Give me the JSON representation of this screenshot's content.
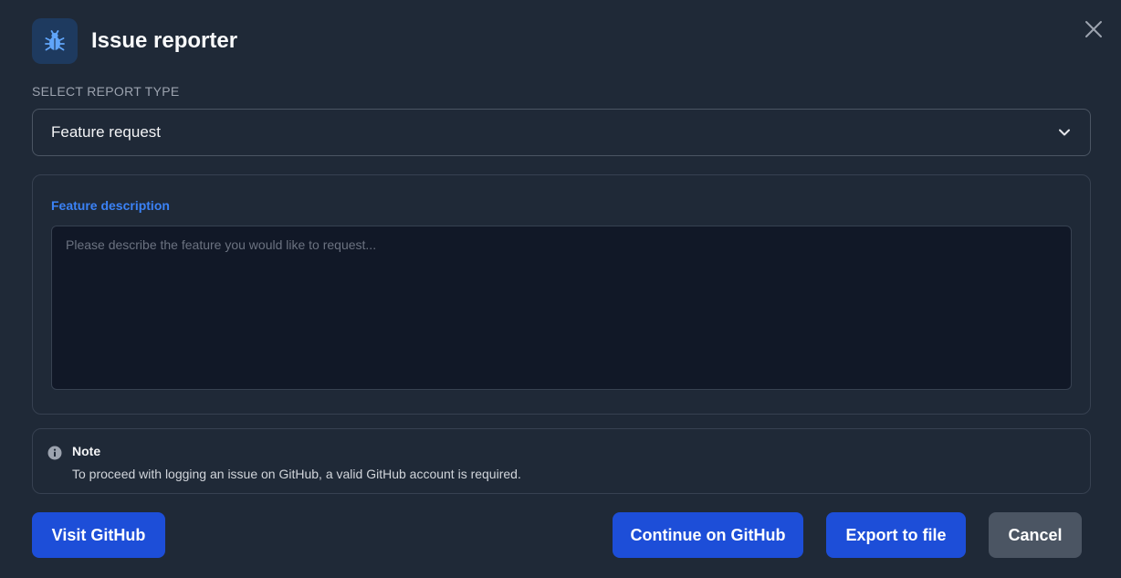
{
  "header": {
    "title": "Issue reporter",
    "icon": "bug-icon"
  },
  "report_type": {
    "section_label": "SELECT REPORT TYPE",
    "selected": "Feature request"
  },
  "feature": {
    "label": "Feature description",
    "value": "",
    "placeholder": "Please describe the feature you would like to request..."
  },
  "note": {
    "title": "Note",
    "text": "To proceed with logging an issue on GitHub, a valid GitHub account is required.",
    "icon": "info-icon"
  },
  "actions": {
    "visit_github": "Visit GitHub",
    "continue_github": "Continue on GitHub",
    "export_file": "Export to file",
    "cancel": "Cancel"
  },
  "colors": {
    "background": "#1f2937",
    "accent": "#1d4ed8",
    "label_accent": "#3b82f6",
    "secondary": "#4b5563"
  }
}
